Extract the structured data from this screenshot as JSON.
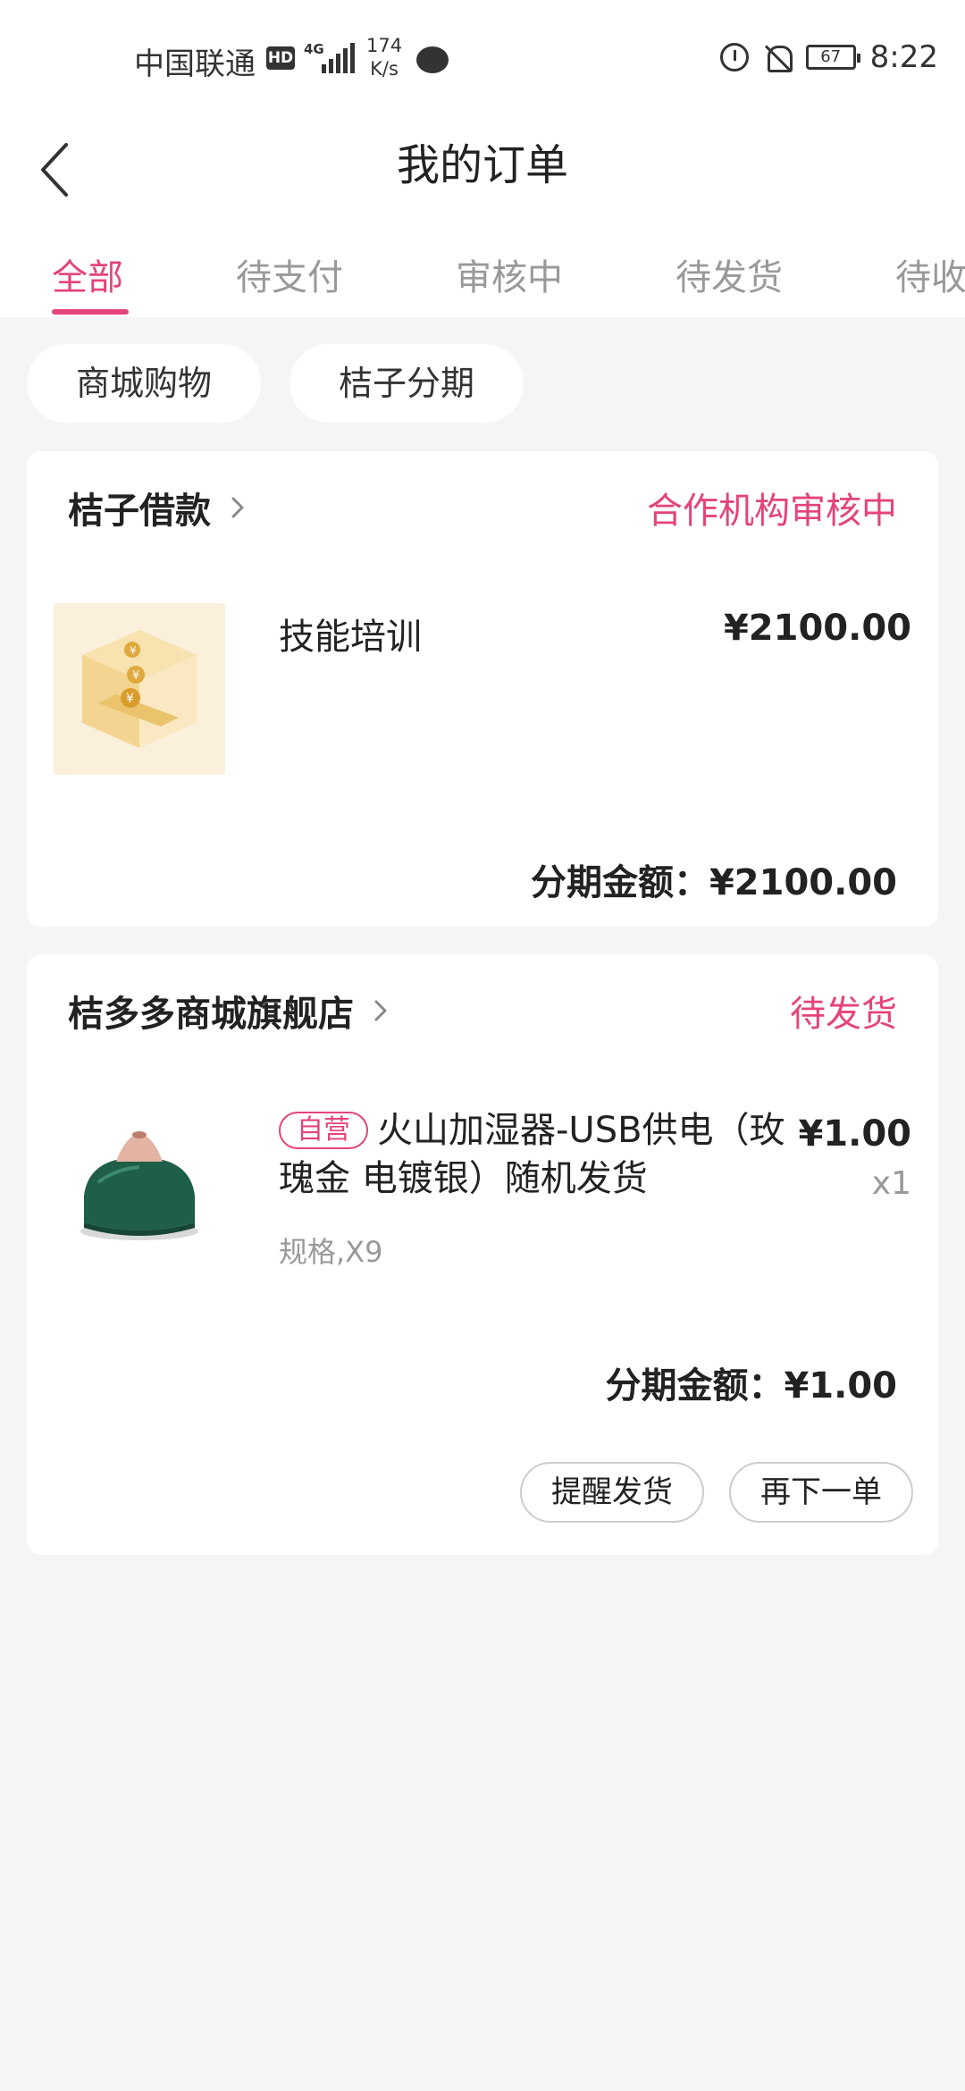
{
  "status_bar": {
    "carrier": "中国联通",
    "hd": "HD",
    "network": "4G",
    "speed_value": "174",
    "speed_unit": "K/s",
    "battery": "67",
    "time": "8:22"
  },
  "header": {
    "title": "我的订单"
  },
  "tabs": [
    {
      "label": "全部",
      "active": true
    },
    {
      "label": "待支付"
    },
    {
      "label": "审核中"
    },
    {
      "label": "待发货"
    },
    {
      "label": "待收"
    }
  ],
  "filters": [
    "商城购物",
    "桔子分期"
  ],
  "orders": [
    {
      "store": "桔子借款",
      "status": "合作机构审核中",
      "product_title": "技能培训",
      "price": "¥2100.00",
      "total": "分期金额：¥2100.00"
    },
    {
      "store": "桔多多商城旗舰店",
      "status": "待发货",
      "tag": "自营",
      "product_title": "火山加湿器-USB供电（玫瑰金 电镀银）随机发货",
      "spec": "规格,X9",
      "price": "¥1.00",
      "qty": "x1",
      "total": "分期金额：¥1.00",
      "buttons": {
        "remind": "提醒发货",
        "reorder": "再下一单"
      }
    }
  ],
  "colors": {
    "accent": "#e4447a",
    "background": "#f5f5f5"
  }
}
